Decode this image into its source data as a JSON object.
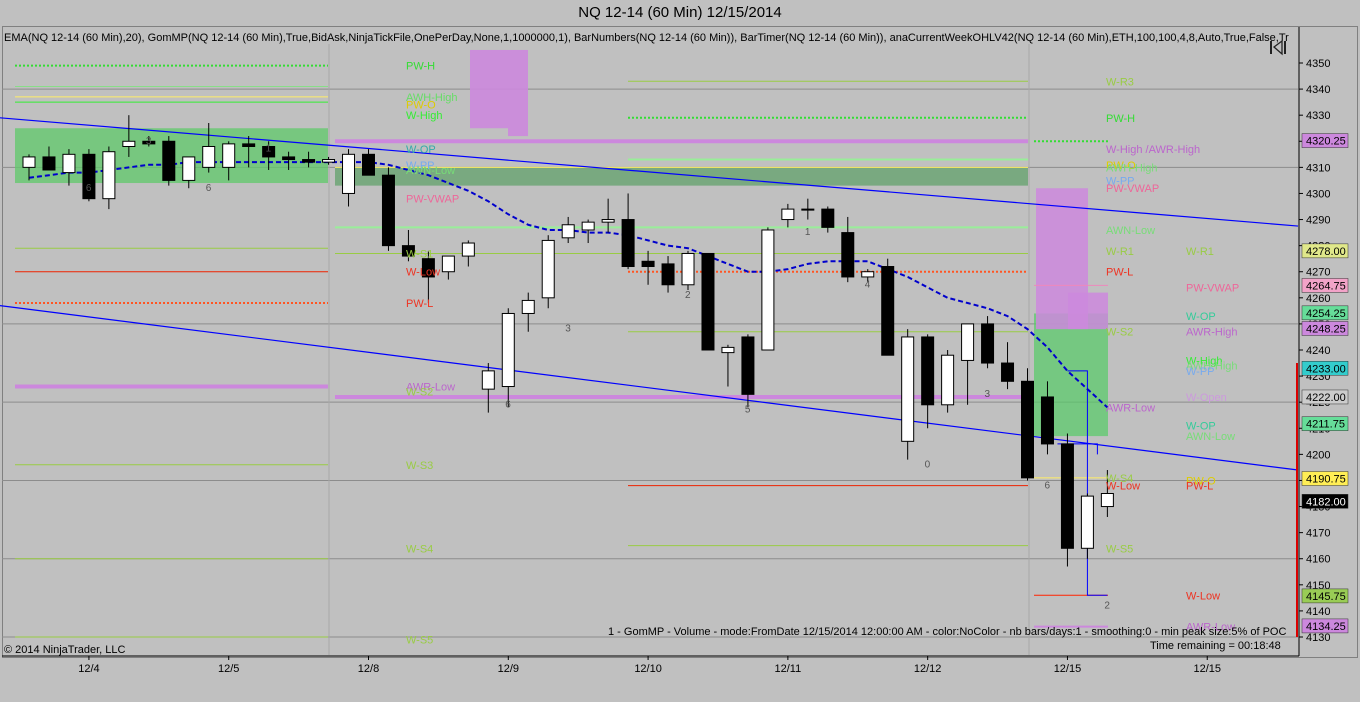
{
  "window": {
    "title": "NQ 12-14 (60 Min)  12/15/2014"
  },
  "indicator_line": "EMA(NQ 12-14 (60 Min),20), GomMP(NQ 12-14 (60 Min),True,BidAsk,NinjaTickFile,OnePerDay,None,1,1000000,1), BarNumbers(NQ 12-14 (60 Min)), BarTimer(NQ 12-14 (60 Min)), anaCurrentWeekOHLV42(NQ 12-14 (60 Min),ETH,100,100,4,8,Auto,True,False,Tr",
  "gommp_note": "1 - GomMP - Volume - mode:FromDate 12/15/2014 12:00:00 AM  - color:NoColor - nb bars/days:1 - smoothing:0 - min peak size:5% of POC",
  "time_remaining": "Time remaining = 00:18:48",
  "copyright": "© 2014 NinjaTrader, LLC",
  "colors": {
    "background": "#c0c0c0",
    "up_candle": "#ffffff",
    "down_candle": "#000000",
    "ema": "#0000cc",
    "trendline": "#0000ff",
    "value_area": "#66cc66",
    "profile": "#cc88dd"
  },
  "icons": {
    "replay": "replay-icon"
  },
  "chart_data": {
    "type": "candlestick",
    "title": "NQ 12-14 (60 Min)  12/15/2014",
    "ylim": [
      4125,
      4365
    ],
    "y_ticks": [
      4130,
      4140,
      4150,
      4160,
      4170,
      4180,
      4190,
      4200,
      4210,
      4220,
      4230,
      4240,
      4250,
      4260,
      4270,
      4280,
      4290,
      4300,
      4310,
      4320,
      4330,
      4340,
      4350
    ],
    "x_ticks": [
      {
        "bar": 2.5,
        "label": "12/4"
      },
      {
        "bar": 9.5,
        "label": "12/5"
      },
      {
        "bar": 16.5,
        "label": "12/8"
      },
      {
        "bar": 23.5,
        "label": "12/9"
      },
      {
        "bar": 30.5,
        "label": "12/10"
      },
      {
        "bar": 37.5,
        "label": "12/11"
      },
      {
        "bar": 44.5,
        "label": "12/12"
      },
      {
        "bar": 51.5,
        "label": "12/15"
      },
      {
        "bar": 58.5,
        "label": "12/15"
      }
    ],
    "candles": [
      {
        "o": 4310,
        "h": 4315,
        "l": 4305,
        "c": 4314
      },
      {
        "o": 4314,
        "h": 4318,
        "l": 4311,
        "c": 4309
      },
      {
        "o": 4308,
        "h": 4317,
        "l": 4303,
        "c": 4315
      },
      {
        "o": 4315,
        "h": 4317,
        "l": 4297,
        "c": 4298
      },
      {
        "o": 4298,
        "h": 4318,
        "l": 4294,
        "c": 4316
      },
      {
        "o": 4318,
        "h": 4330,
        "l": 4314,
        "c": 4320
      },
      {
        "o": 4320,
        "h": 4322,
        "l": 4318,
        "c": 4319
      },
      {
        "o": 4320,
        "h": 4322,
        "l": 4303,
        "c": 4305
      },
      {
        "o": 4305,
        "h": 4314,
        "l": 4302,
        "c": 4314
      },
      {
        "o": 4310,
        "h": 4327,
        "l": 4308,
        "c": 4318
      },
      {
        "o": 4310,
        "h": 4320,
        "l": 4305,
        "c": 4319
      },
      {
        "o": 4319,
        "h": 4322,
        "l": 4310,
        "c": 4318
      },
      {
        "o": 4318,
        "h": 4320,
        "l": 4309,
        "c": 4314
      },
      {
        "o": 4314,
        "h": 4316,
        "l": 4309,
        "c": 4313
      },
      {
        "o": 4313,
        "h": 4316,
        "l": 4310,
        "c": 4312
      },
      {
        "o": 4312,
        "h": 4314,
        "l": 4311,
        "c": 4313
      },
      {
        "o": 4300,
        "h": 4317,
        "l": 4295,
        "c": 4315
      },
      {
        "o": 4315,
        "h": 4317,
        "l": 4307,
        "c": 4307
      },
      {
        "o": 4307,
        "h": 4310,
        "l": 4278,
        "c": 4280
      },
      {
        "o": 4280,
        "h": 4286,
        "l": 4274,
        "c": 4276
      },
      {
        "o": 4275,
        "h": 4278,
        "l": 4258,
        "c": 4268
      },
      {
        "o": 4270,
        "h": 4276,
        "l": 4267,
        "c": 4276
      },
      {
        "o": 4276,
        "h": 4282,
        "l": 4272,
        "c": 4281
      },
      {
        "o": 4225,
        "h": 4235,
        "l": 4216,
        "c": 4232
      },
      {
        "o": 4226,
        "h": 4256,
        "l": 4218,
        "c": 4254
      },
      {
        "o": 4254,
        "h": 4262,
        "l": 4247,
        "c": 4259
      },
      {
        "o": 4260,
        "h": 4284,
        "l": 4256,
        "c": 4282
      },
      {
        "o": 4283,
        "h": 4291,
        "l": 4281,
        "c": 4288
      },
      {
        "o": 4286,
        "h": 4290,
        "l": 4281,
        "c": 4289
      },
      {
        "o": 4289,
        "h": 4298,
        "l": 4285,
        "c": 4290
      },
      {
        "o": 4290,
        "h": 4300,
        "l": 4271,
        "c": 4272
      },
      {
        "o": 4274,
        "h": 4278,
        "l": 4265,
        "c": 4272
      },
      {
        "o": 4273,
        "h": 4276,
        "l": 4262,
        "c": 4265
      },
      {
        "o": 4265,
        "h": 4278,
        "l": 4263,
        "c": 4277
      },
      {
        "o": 4277,
        "h": 4277,
        "l": 4240,
        "c": 4240
      },
      {
        "o": 4239,
        "h": 4242,
        "l": 4226,
        "c": 4241
      },
      {
        "o": 4245,
        "h": 4246,
        "l": 4218,
        "c": 4223
      },
      {
        "o": 4240,
        "h": 4287,
        "l": 4240,
        "c": 4286
      },
      {
        "o": 4290,
        "h": 4296,
        "l": 4287,
        "c": 4294
      },
      {
        "o": 4294,
        "h": 4298,
        "l": 4290,
        "c": 4294
      },
      {
        "o": 4294,
        "h": 4295,
        "l": 4285,
        "c": 4287
      },
      {
        "o": 4285,
        "h": 4291,
        "l": 4266,
        "c": 4268
      },
      {
        "o": 4268,
        "h": 4271,
        "l": 4266,
        "c": 4270
      },
      {
        "o": 4272,
        "h": 4275,
        "l": 4238,
        "c": 4238
      },
      {
        "o": 4205,
        "h": 4248,
        "l": 4198,
        "c": 4245
      },
      {
        "o": 4245,
        "h": 4246,
        "l": 4210,
        "c": 4219
      },
      {
        "o": 4219,
        "h": 4240,
        "l": 4216,
        "c": 4238
      },
      {
        "o": 4236,
        "h": 4250,
        "l": 4219,
        "c": 4250
      },
      {
        "o": 4250,
        "h": 4253,
        "l": 4233,
        "c": 4235
      },
      {
        "o": 4235,
        "h": 4243,
        "l": 4225,
        "c": 4228
      },
      {
        "o": 4228,
        "h": 4233,
        "l": 4190,
        "c": 4191
      },
      {
        "o": 4222,
        "h": 4228,
        "l": 4200,
        "c": 4204
      },
      {
        "o": 4204,
        "h": 4208,
        "l": 4157,
        "c": 4164
      },
      {
        "o": 4164,
        "h": 4185,
        "l": 4160,
        "c": 4184
      },
      {
        "o": 4180,
        "h": 4194,
        "l": 4176,
        "c": 4185
      }
    ],
    "ema": [
      4306,
      4307,
      4308,
      4308,
      4309,
      4310,
      4311,
      4311,
      4312,
      4312,
      4312,
      4312,
      4312,
      4312,
      4312,
      4312,
      4312,
      4312,
      4311,
      4309,
      4307,
      4304,
      4301,
      4297,
      4292,
      4288,
      4286,
      4286,
      4285,
      4285,
      4284,
      4282,
      4280,
      4279,
      4276,
      4273,
      4270,
      4270,
      4271,
      4273,
      4274,
      4274,
      4274,
      4271,
      4268,
      4264,
      4260,
      4258,
      4256,
      4253,
      4248,
      4241,
      4232,
      4225,
      4218
    ],
    "right_labels": [
      {
        "value": 4320.25,
        "label": "4320.25",
        "bg": "#cc88dd"
      },
      {
        "value": 4278,
        "label": "4278.00",
        "bg": "#e0e88a"
      },
      {
        "value": 4264.75,
        "label": "4264.75",
        "bg": "#f2a3c8"
      },
      {
        "value": 4254.25,
        "label": "4254.25",
        "bg": "#66dd99"
      },
      {
        "value": 4248.25,
        "label": "4248.25",
        "bg": "#cc88dd"
      },
      {
        "value": 4233,
        "label": "4233.00",
        "bg": "#33cccc"
      },
      {
        "value": 4222,
        "label": "4222.00",
        "bg": "#cccccc"
      },
      {
        "value": 4211.75,
        "label": "4211.75",
        "bg": "#66dd99"
      },
      {
        "value": 4190.75,
        "label": "4190.75",
        "bg": "#ffee55"
      },
      {
        "value": 4182,
        "label": "4182.00",
        "bg": "#000000",
        "fg": "#ffffff"
      },
      {
        "value": 4145.75,
        "label": "4145.75",
        "bg": "#99cc55"
      },
      {
        "value": 4134.25,
        "label": "4134.25",
        "bg": "#cc88dd"
      }
    ],
    "level_labels": [
      {
        "text": "PW-H",
        "bar": 19,
        "value": 4349,
        "color": "#33dd33"
      },
      {
        "text": "AWH-High",
        "bar": 19,
        "value": 4337,
        "color": "#66dd66"
      },
      {
        "text": "PW-O",
        "bar": 19,
        "value": 4334,
        "color": "#ddcc00"
      },
      {
        "text": "W-High",
        "bar": 19,
        "value": 4330,
        "color": "#33ee33"
      },
      {
        "text": "W-OP",
        "bar": 19,
        "value": 4317,
        "color": "#33aaaa"
      },
      {
        "text": "W-PP",
        "bar": 19,
        "value": 4311,
        "color": "#77aaee"
      },
      {
        "text": "AWN-Low",
        "bar": 19,
        "value": 4309,
        "color": "#77dd77"
      },
      {
        "text": "PW-VWAP",
        "bar": 19,
        "value": 4298,
        "color": "#ee6699"
      },
      {
        "text": "W-S1",
        "bar": 19,
        "value": 4277,
        "color": "#99cc44"
      },
      {
        "text": "W-Low",
        "bar": 19,
        "value": 4270,
        "color": "#ee3322"
      },
      {
        "text": "PW-L",
        "bar": 19,
        "value": 4258,
        "color": "#ee3322"
      },
      {
        "text": "AWR-Low",
        "bar": 19,
        "value": 4226,
        "color": "#bb66cc"
      },
      {
        "text": "W-S2",
        "bar": 19,
        "value": 4224,
        "color": "#99cc44"
      },
      {
        "text": "W-S3",
        "bar": 19,
        "value": 4196,
        "color": "#99cc44"
      },
      {
        "text": "W-S4",
        "bar": 19,
        "value": 4164,
        "color": "#99cc44"
      },
      {
        "text": "W-S5",
        "bar": 19,
        "value": 4129,
        "color": "#99cc44"
      },
      {
        "text": "W-R3",
        "bar": 52,
        "value": 4343,
        "color": "#99cc44"
      },
      {
        "text": "PW-H",
        "bar": 52,
        "value": 4329,
        "color": "#33dd33"
      },
      {
        "text": "W-High /AWR-High",
        "bar": 52,
        "value": 4317,
        "color": "#bb66cc"
      },
      {
        "text": "PW-O",
        "bar": 52,
        "value": 4311,
        "color": "#ddcc00"
      },
      {
        "text": "AWH-High",
        "bar": 52,
        "value": 4310,
        "color": "#77dd77"
      },
      {
        "text": "W-PP",
        "bar": 52,
        "value": 4305,
        "color": "#77aaee"
      },
      {
        "text": "PW-VWAP",
        "bar": 52,
        "value": 4302,
        "color": "#ee6699"
      },
      {
        "text": "AWN-Low",
        "bar": 52,
        "value": 4286,
        "color": "#77dd77"
      },
      {
        "text": "W-R1",
        "bar": 52,
        "value": 4278,
        "color": "#99cc44"
      },
      {
        "text": "PW-L",
        "bar": 52,
        "value": 4270,
        "color": "#ee3322"
      },
      {
        "text": "W-S2",
        "bar": 52,
        "value": 4247,
        "color": "#99cc44"
      },
      {
        "text": "AWR-Low",
        "bar": 52,
        "value": 4218,
        "color": "#bb66cc"
      },
      {
        "text": "W-S4",
        "bar": 52,
        "value": 4191,
        "color": "#99cc44"
      },
      {
        "text": "W-Low",
        "bar": 52,
        "value": 4188,
        "color": "#ee3322"
      },
      {
        "text": "W-S5",
        "bar": 52,
        "value": 4164,
        "color": "#99cc44"
      },
      {
        "text": "W-R1",
        "bar": 56,
        "value": 4278,
        "color": "#99cc44"
      },
      {
        "text": "PW-VWAP",
        "bar": 56,
        "value": 4264,
        "color": "#ee6699"
      },
      {
        "text": "W-OP",
        "bar": 56,
        "value": 4253,
        "color": "#33cc99"
      },
      {
        "text": "AWR-High",
        "bar": 56,
        "value": 4247,
        "color": "#bb66cc"
      },
      {
        "text": "W-High",
        "bar": 56,
        "value": 4236,
        "color": "#33ee33"
      },
      {
        "text": "AWH-High",
        "bar": 56,
        "value": 4234,
        "color": "#77dd77"
      },
      {
        "text": "W-PP",
        "bar": 56,
        "value": 4232,
        "color": "#77aaee"
      },
      {
        "text": "W-Open",
        "bar": 56,
        "value": 4222,
        "color": "#cc99dd"
      },
      {
        "text": "W-OP",
        "bar": 56,
        "value": 4211,
        "color": "#33cc99"
      },
      {
        "text": "AWN-Low",
        "bar": 56,
        "value": 4207,
        "color": "#77dd77"
      },
      {
        "text": "PW-O",
        "bar": 56,
        "value": 4190,
        "color": "#ddcc00"
      },
      {
        "text": "PW-L",
        "bar": 56,
        "value": 4188,
        "color": "#ee3322"
      },
      {
        "text": "W-Low",
        "bar": 56,
        "value": 4146,
        "color": "#ee3322"
      },
      {
        "text": "AWR-Low",
        "bar": 56,
        "value": 4134,
        "color": "#bb66cc"
      }
    ],
    "bar_numbers": [
      {
        "bar": 3,
        "text": "6",
        "value": 4301
      },
      {
        "bar": 6,
        "text": "3",
        "value": 4319
      },
      {
        "bar": 9,
        "text": "6",
        "value": 4301
      },
      {
        "bar": 12,
        "text": "1",
        "value": 4316
      },
      {
        "bar": 27,
        "text": "3",
        "value": 4247
      },
      {
        "bar": 24,
        "text": "6",
        "value": 4218
      },
      {
        "bar": 33,
        "text": "2",
        "value": 4260
      },
      {
        "bar": 36,
        "text": "5",
        "value": 4216
      },
      {
        "bar": 39,
        "text": "1",
        "value": 4284
      },
      {
        "bar": 42,
        "text": "4",
        "value": 4264
      },
      {
        "bar": 45,
        "text": "0",
        "value": 4195
      },
      {
        "bar": 48,
        "text": "3",
        "value": 4222
      },
      {
        "bar": 51,
        "text": "6",
        "value": 4187
      },
      {
        "bar": 54,
        "text": "2",
        "value": 4141
      }
    ]
  }
}
